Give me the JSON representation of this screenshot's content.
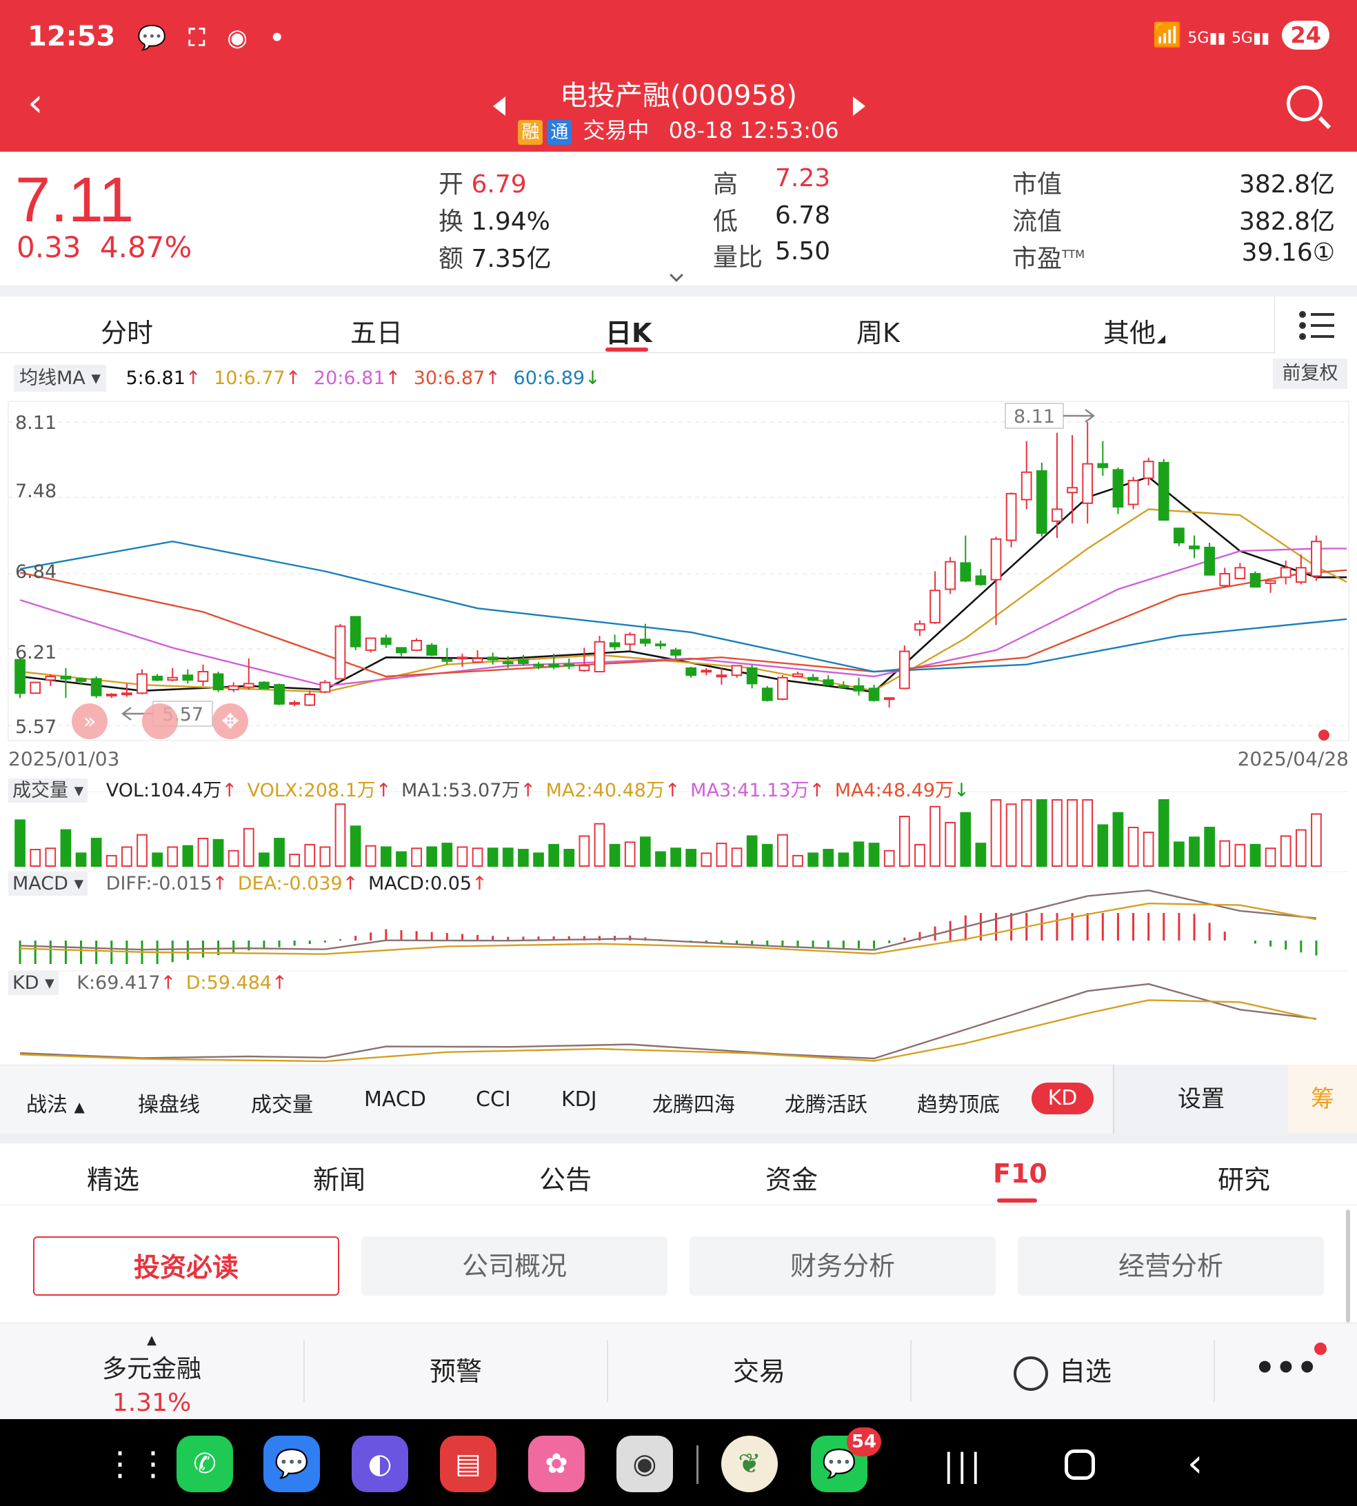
{
  "status_bar": {
    "time": "12:53",
    "battery": "24",
    "icons": [
      "wechat-icon",
      "screenshot-icon",
      "buds-icon",
      "dot-icon"
    ],
    "right_icons": [
      "wifi-icon",
      "signal-5g-icon",
      "signal-5g-icon"
    ]
  },
  "header": {
    "title": "电投产融(000958)",
    "tag_rong": "融",
    "tag_tong": "通",
    "status": "交易中",
    "datetime": "08-18 12:53:06",
    "color": "#e8333e"
  },
  "quote": {
    "price": "7.11",
    "change": "0.33",
    "change_pct": "4.87%",
    "open_label": "开",
    "open": "6.79",
    "turnover_label": "换",
    "turnover": "1.94%",
    "amount_label": "额",
    "amount": "7.35亿",
    "high_label": "高",
    "high": "7.23",
    "low_label": "低",
    "low": "6.78",
    "volratio_label": "量比",
    "volratio": "5.50",
    "mktcap_label": "市值",
    "mktcap": "382.8亿",
    "float_label": "流值",
    "float": "382.8亿",
    "pe_label": "市盈",
    "pe_sup": "TTM",
    "pe": "39.16①"
  },
  "period_tabs": [
    "分时",
    "五日",
    "日K",
    "周K",
    "其他"
  ],
  "active_period": "日K",
  "ma_legend": {
    "label": "均线MA",
    "ma5": "5:6.81",
    "ma10": "10:6.77",
    "ma20": "20:6.81",
    "ma30": "30:6.87",
    "ma60": "60:6.89",
    "fq": "前复权"
  },
  "chart_labels": {
    "y_top": "8.11",
    "y2": "7.48",
    "y3": "6.84",
    "y4": "6.21",
    "y_bot": "5.57",
    "date_start": "2025/01/03",
    "date_end": "2025/04/28",
    "max_tag": "8.11",
    "min_tag": "5.57"
  },
  "vol_legend": {
    "label": "成交量",
    "vol": "VOL:104.4万",
    "volx": "VOLX:208.1万",
    "ma1": "MA1:53.07万",
    "ma2": "MA2:40.48万",
    "ma3": "MA3:41.13万",
    "ma4": "MA4:48.49万"
  },
  "macd_legend": {
    "label": "MACD",
    "diff": "DIFF:-0.015",
    "dea": "DEA:-0.039",
    "macd": "MACD:0.05"
  },
  "kd_legend": {
    "label": "KD",
    "k": "K:69.417",
    "d": "D:59.484"
  },
  "indicator_bar": {
    "items": [
      "战法",
      "操盘线",
      "成交量",
      "MACD",
      "CCI",
      "KDJ",
      "龙腾四海",
      "龙腾活跃",
      "趋势顶底",
      "KD"
    ],
    "settings": "设置",
    "chou": "筹"
  },
  "news_tabs": [
    "精选",
    "新闻",
    "公告",
    "资金",
    "F10",
    "研究"
  ],
  "active_news": "F10",
  "f10_buttons": [
    "投资必读",
    "公司概况",
    "财务分析",
    "经营分析"
  ],
  "footer": {
    "sector": "多元金融",
    "sector_pct": "1.31%",
    "alert": "预警",
    "trade": "交易",
    "watch": "自选"
  },
  "dock": {
    "wechat_badge": "54"
  },
  "chart_data": {
    "type": "candlestick",
    "x_start": "2025/01/03",
    "x_end": "2025/04/28",
    "ylim": [
      5.57,
      8.11
    ],
    "yticks": [
      8.11,
      7.48,
      6.84,
      6.21,
      5.57
    ],
    "ohlc": [
      [
        6.12,
        6.13,
        5.8,
        5.84
      ],
      [
        5.84,
        5.93,
        5.84,
        5.93
      ],
      [
        5.95,
        6.0,
        5.9,
        5.98
      ],
      [
        5.98,
        6.05,
        5.8,
        5.96
      ],
      [
        5.96,
        5.97,
        5.91,
        5.94
      ],
      [
        5.96,
        5.98,
        5.8,
        5.82
      ],
      [
        5.82,
        5.84,
        5.8,
        5.83
      ],
      [
        5.83,
        5.92,
        5.81,
        5.84
      ],
      [
        5.84,
        6.04,
        5.83,
        6.0
      ],
      [
        5.98,
        6.0,
        5.94,
        5.95
      ],
      [
        5.95,
        6.05,
        5.94,
        5.97
      ],
      [
        5.99,
        6.04,
        5.92,
        5.95
      ],
      [
        5.94,
        6.08,
        5.9,
        6.02
      ],
      [
        6.0,
        6.02,
        5.85,
        5.87
      ],
      [
        5.87,
        5.93,
        5.85,
        5.9
      ],
      [
        5.89,
        6.13,
        5.87,
        5.92
      ],
      [
        5.93,
        5.94,
        5.88,
        5.88
      ],
      [
        5.91,
        5.92,
        5.74,
        5.75
      ],
      [
        5.75,
        5.78,
        5.73,
        5.76
      ],
      [
        5.74,
        5.86,
        5.73,
        5.83
      ],
      [
        5.85,
        5.95,
        5.84,
        5.93
      ],
      [
        5.96,
        6.42,
        5.96,
        6.4
      ],
      [
        6.48,
        6.48,
        6.2,
        6.23
      ],
      [
        6.2,
        6.3,
        6.18,
        6.3
      ],
      [
        6.3,
        6.33,
        6.22,
        6.25
      ],
      [
        6.22,
        6.22,
        6.15,
        6.18
      ],
      [
        6.2,
        6.3,
        6.2,
        6.28
      ],
      [
        6.24,
        6.26,
        6.15,
        6.16
      ],
      [
        6.12,
        6.22,
        6.08,
        6.11
      ],
      [
        6.13,
        6.17,
        6.06,
        6.14
      ],
      [
        6.1,
        6.2,
        6.1,
        6.13
      ],
      [
        6.14,
        6.18,
        6.08,
        6.12
      ],
      [
        6.1,
        6.15,
        6.05,
        6.09
      ],
      [
        6.12,
        6.16,
        6.07,
        6.09
      ],
      [
        6.08,
        6.1,
        6.04,
        6.07
      ],
      [
        6.08,
        6.17,
        6.04,
        6.06
      ],
      [
        6.08,
        6.13,
        6.04,
        6.07
      ],
      [
        6.03,
        6.22,
        6.02,
        6.07
      ],
      [
        6.02,
        6.32,
        6.02,
        6.27
      ],
      [
        6.26,
        6.33,
        6.2,
        6.23
      ],
      [
        6.25,
        6.35,
        6.2,
        6.33
      ],
      [
        6.29,
        6.42,
        6.23,
        6.26
      ],
      [
        6.25,
        6.28,
        6.21,
        6.24
      ],
      [
        6.2,
        6.22,
        6.12,
        6.16
      ],
      [
        6.05,
        6.06,
        5.97,
        5.99
      ],
      [
        6.02,
        6.05,
        5.99,
        6.03
      ],
      [
        5.99,
        6.05,
        5.91,
        5.99
      ],
      [
        5.99,
        6.07,
        5.97,
        6.07
      ],
      [
        6.05,
        6.08,
        5.88,
        5.92
      ],
      [
        5.88,
        5.9,
        5.77,
        5.78
      ],
      [
        5.79,
        5.99,
        5.78,
        5.97
      ],
      [
        5.98,
        6.02,
        5.98,
        6.0
      ],
      [
        5.97,
        6.0,
        5.94,
        5.95
      ],
      [
        5.95,
        5.99,
        5.9,
        5.91
      ],
      [
        5.9,
        5.94,
        5.88,
        5.89
      ],
      [
        5.9,
        5.97,
        5.82,
        5.86
      ],
      [
        5.88,
        5.91,
        5.77,
        5.78
      ],
      [
        5.79,
        5.8,
        5.72,
        5.8
      ],
      [
        5.88,
        6.24,
        5.88,
        6.19
      ],
      [
        6.37,
        6.45,
        6.32,
        6.42
      ],
      [
        6.43,
        6.86,
        6.42,
        6.7
      ],
      [
        6.71,
        6.98,
        6.67,
        6.94
      ],
      [
        6.93,
        7.16,
        6.77,
        6.78
      ],
      [
        6.82,
        6.88,
        6.74,
        6.75
      ],
      [
        6.79,
        7.15,
        6.41,
        7.13
      ],
      [
        7.12,
        7.52,
        7.06,
        7.51
      ],
      [
        7.46,
        7.95,
        7.38,
        7.69
      ],
      [
        7.7,
        7.77,
        7.15,
        7.18
      ],
      [
        7.28,
        8.02,
        7.14,
        7.38
      ],
      [
        7.52,
        8.0,
        7.26,
        7.56
      ],
      [
        7.43,
        8.11,
        7.26,
        7.76
      ],
      [
        7.76,
        7.95,
        7.66,
        7.73
      ],
      [
        7.71,
        7.73,
        7.34,
        7.4
      ],
      [
        7.42,
        7.65,
        7.38,
        7.62
      ],
      [
        7.64,
        7.81,
        7.58,
        7.78
      ],
      [
        7.77,
        7.8,
        7.29,
        7.29
      ],
      [
        7.22,
        7.22,
        7.07,
        7.1
      ],
      [
        7.07,
        7.16,
        6.97,
        7.05
      ],
      [
        7.06,
        7.1,
        6.83,
        6.83
      ],
      [
        6.74,
        6.89,
        6.73,
        6.84
      ],
      [
        6.8,
        6.93,
        6.8,
        6.89
      ],
      [
        6.84,
        6.86,
        6.73,
        6.73
      ],
      [
        6.76,
        6.78,
        6.68,
        6.78
      ],
      [
        6.81,
        6.95,
        6.75,
        6.89
      ],
      [
        6.77,
        7.0,
        6.75,
        6.89
      ],
      [
        6.82,
        7.16,
        6.78,
        7.11
      ]
    ],
    "ma_series": [
      {
        "name": "MA5",
        "color": "#111111",
        "anchors": [
          [
            0,
            5.98
          ],
          [
            8,
            5.86
          ],
          [
            15,
            5.9
          ],
          [
            20,
            5.87
          ],
          [
            24,
            6.14
          ],
          [
            32,
            6.13
          ],
          [
            40,
            6.19
          ],
          [
            50,
            5.95
          ],
          [
            56,
            5.85
          ],
          [
            62,
            6.55
          ],
          [
            70,
            7.48
          ],
          [
            74,
            7.65
          ],
          [
            80,
            7.03
          ],
          [
            85,
            6.81
          ],
          [
            87,
            6.81
          ]
        ]
      },
      {
        "name": "MA10",
        "color": "#d4a020",
        "anchors": [
          [
            0,
            6.02
          ],
          [
            8,
            5.91
          ],
          [
            20,
            5.85
          ],
          [
            28,
            6.08
          ],
          [
            38,
            6.16
          ],
          [
            48,
            6.05
          ],
          [
            56,
            5.86
          ],
          [
            62,
            6.3
          ],
          [
            70,
            7.05
          ],
          [
            74,
            7.38
          ],
          [
            80,
            7.33
          ],
          [
            85,
            6.9
          ],
          [
            87,
            6.77
          ]
        ]
      },
      {
        "name": "MA20",
        "color": "#d060d8",
        "anchors": [
          [
            0,
            6.62
          ],
          [
            10,
            6.22
          ],
          [
            20,
            5.9
          ],
          [
            32,
            6.07
          ],
          [
            44,
            6.13
          ],
          [
            56,
            5.98
          ],
          [
            64,
            6.2
          ],
          [
            72,
            6.71
          ],
          [
            80,
            7.03
          ],
          [
            85,
            7.05
          ],
          [
            87,
            7.05
          ]
        ]
      },
      {
        "name": "MA30",
        "color": "#e25030",
        "anchors": [
          [
            0,
            6.85
          ],
          [
            12,
            6.52
          ],
          [
            24,
            5.98
          ],
          [
            36,
            6.07
          ],
          [
            46,
            6.14
          ],
          [
            56,
            6.02
          ],
          [
            66,
            6.14
          ],
          [
            76,
            6.66
          ],
          [
            84,
            6.84
          ],
          [
            87,
            6.87
          ]
        ]
      },
      {
        "name": "MA60",
        "color": "#1a7fb8",
        "anchors": [
          [
            0,
            6.88
          ],
          [
            10,
            7.11
          ],
          [
            20,
            6.86
          ],
          [
            30,
            6.55
          ],
          [
            44,
            6.35
          ],
          [
            56,
            6.02
          ],
          [
            66,
            6.08
          ],
          [
            76,
            6.32
          ],
          [
            87,
            6.46
          ]
        ]
      }
    ]
  }
}
